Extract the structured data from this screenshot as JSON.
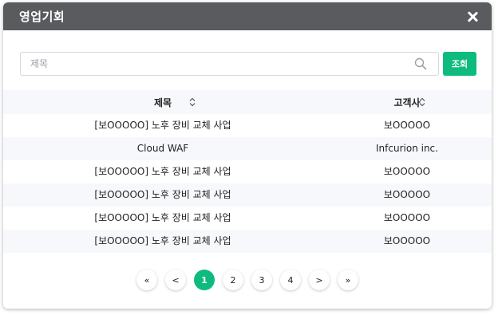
{
  "dialog": {
    "title": "영업기회"
  },
  "search": {
    "placeholder": "제목",
    "value": "",
    "button_label": "조회"
  },
  "table": {
    "headers": [
      "제목",
      "고객사"
    ],
    "rows": [
      [
        "[보OOOOO] 노후 장비 교체 사업",
        "보OOOOO"
      ],
      [
        "Cloud WAF",
        "Infcurion inc."
      ],
      [
        "[보OOOOO] 노후 장비 교체 사업",
        "보OOOOO"
      ],
      [
        "[보OOOOO] 노후 장비 교체 사업",
        "보OOOOO"
      ],
      [
        "[보OOOOO] 노후 장비 교체 사업",
        "보OOOOO"
      ],
      [
        "[보OOOOO] 노후 장비 교체 사업",
        "보OOOOO"
      ]
    ]
  },
  "pagination": {
    "first": "«",
    "prev": "<",
    "pages": [
      "1",
      "2",
      "3",
      "4"
    ],
    "next": ">",
    "last": "»",
    "current": "1"
  },
  "colors": {
    "accent": "#0dbb7e",
    "titlebar": "#5a5b5f"
  },
  "icons": {
    "close": "close-icon",
    "search": "search-icon",
    "sort": "sort-icon"
  }
}
